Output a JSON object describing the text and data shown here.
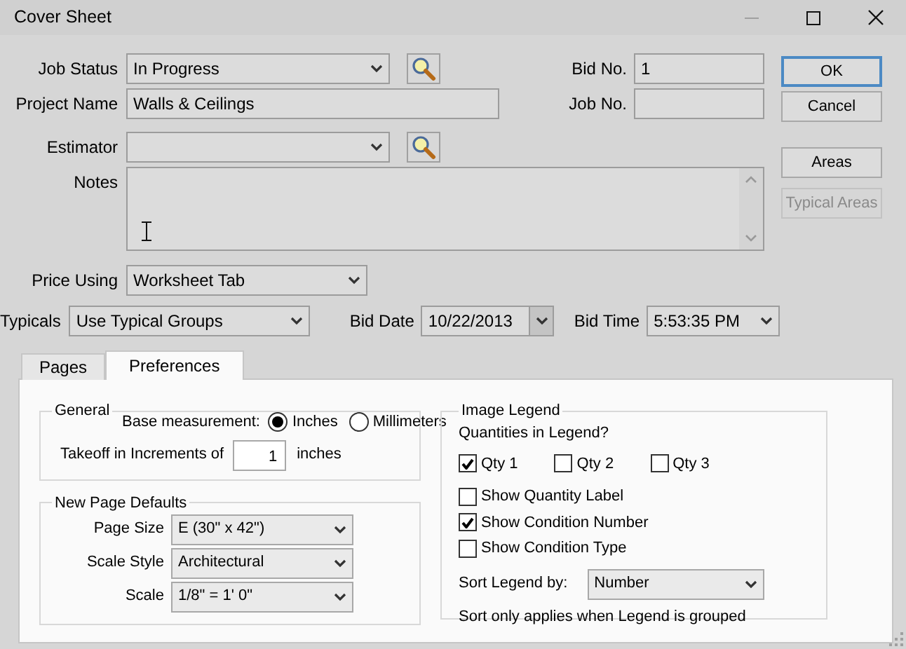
{
  "window": {
    "title": "Cover Sheet"
  },
  "job_status": {
    "label": "Job Status",
    "value": "In Progress"
  },
  "bid_no": {
    "label": "Bid No.",
    "value": "1"
  },
  "project_name": {
    "label": "Project Name",
    "value": "Walls & Ceilings"
  },
  "job_no": {
    "label": "Job No."
  },
  "estimator": {
    "label": "Estimator"
  },
  "notes": {
    "label": "Notes"
  },
  "price_using": {
    "label": "Price Using",
    "value": "Worksheet Tab"
  },
  "typicals": {
    "label": "Typicals",
    "value": "Use Typical Groups"
  },
  "bid_date": {
    "label": "Bid Date",
    "value": "10/22/2013"
  },
  "bid_time": {
    "label": "Bid Time",
    "value": "5:53:35 PM"
  },
  "buttons": [
    {
      "label": "OK",
      "default": true,
      "disabled": false
    },
    {
      "label": "Cancel",
      "default": false,
      "disabled": false
    },
    {
      "label": "Areas",
      "default": false,
      "disabled": false
    },
    {
      "label": "Typical Areas",
      "default": false,
      "disabled": true
    }
  ],
  "tabs": [
    {
      "label": "Pages",
      "selected": false
    },
    {
      "label": "Preferences",
      "selected": true
    }
  ],
  "general": {
    "title": "General",
    "base_label": "Base measurement:",
    "units": [
      {
        "label": "Inches",
        "selected": true
      },
      {
        "label": "Millimeters",
        "selected": false
      }
    ],
    "increment_label": "Takeoff in Increments of",
    "increment_value": "1",
    "increment_unit": "inches"
  },
  "new_page_defaults": {
    "title": "New Page Defaults",
    "fields": [
      {
        "label": "Page Size",
        "value": "E (30\" x 42\")"
      },
      {
        "label": "Scale Style",
        "value": "Architectural"
      },
      {
        "label": "Scale",
        "value": "1/8\" = 1' 0\""
      }
    ]
  },
  "image_legend": {
    "title": "Image Legend",
    "quantities_label": "Quantities in Legend?",
    "quantities": [
      {
        "label": "Qty 1",
        "checked": true
      },
      {
        "label": "Qty 2",
        "checked": false
      },
      {
        "label": "Qty 3",
        "checked": false
      }
    ],
    "options": [
      {
        "label": "Show Quantity Label",
        "checked": false
      },
      {
        "label": "Show Condition Number",
        "checked": true
      },
      {
        "label": "Show Condition Type",
        "checked": false
      }
    ],
    "sort_label": "Sort Legend by:",
    "sort_value": "Number",
    "note": "Sort only applies when Legend is grouped"
  }
}
